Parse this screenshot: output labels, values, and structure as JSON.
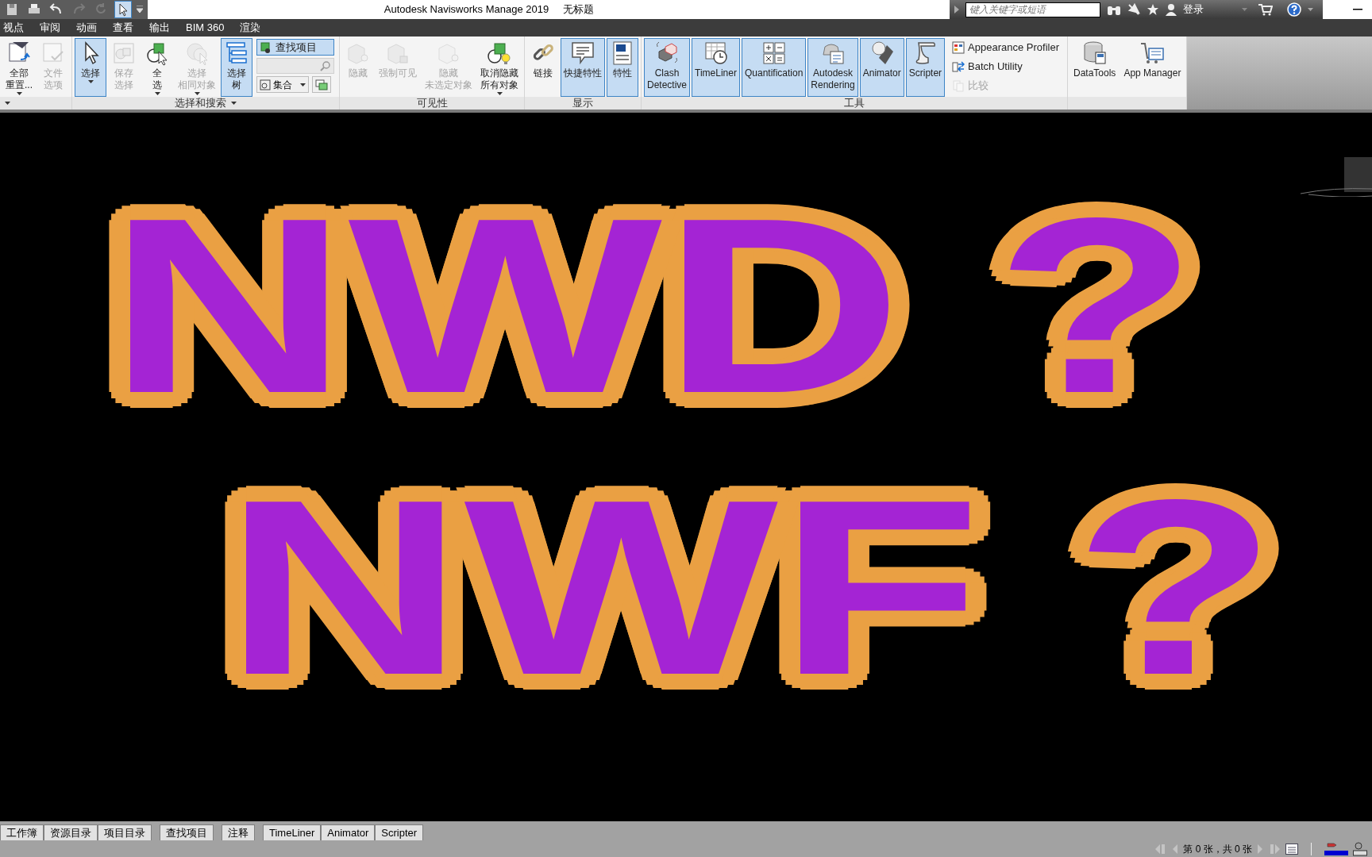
{
  "quick_access": [
    {
      "selected": false,
      "disabled": false
    },
    {
      "selected": false,
      "disabled": false
    },
    {
      "selected": false,
      "disabled": false
    },
    {
      "selected": false,
      "disabled": true
    },
    {
      "selected": false,
      "disabled": true
    },
    {
      "selected": true,
      "disabled": false
    }
  ],
  "title": "Autodesk Navisworks Manage 2019",
  "document": "无标题",
  "infocenter": {
    "placeholder": "键入关键字或短语",
    "login": "登录"
  },
  "menu": [
    "视点",
    "审阅",
    "动画",
    "查看",
    "输出",
    "BIM 360",
    "渲染"
  ],
  "ribbon": [
    {
      "menu": true,
      "items": [
        {
          "kind": "large",
          "lines": [
            "全部",
            "重置..."
          ],
          "dropdown": true,
          "disabled": false,
          "active": false
        },
        {
          "kind": "large",
          "lines": [
            "文件",
            "选项"
          ],
          "dropdown": false,
          "disabled": true,
          "active": false
        }
      ]
    },
    {
      "label": "选择和搜索",
      "menu": true,
      "items": [
        {
          "kind": "large",
          "label": "选择",
          "dropdown": true,
          "disabled": false,
          "active": true
        },
        {
          "kind": "large",
          "lines": [
            "保存",
            "选择"
          ],
          "dropdown": false,
          "disabled": true,
          "active": false
        },
        {
          "kind": "large",
          "lines": [
            "全",
            "选"
          ],
          "dropdown": true,
          "disabled": false,
          "active": false
        },
        {
          "kind": "large",
          "lines": [
            "选择",
            "相同对象"
          ],
          "dropdown": true,
          "disabled": true,
          "active": false
        },
        {
          "kind": "large",
          "lines": [
            "选择",
            "树"
          ],
          "dropdown": false,
          "disabled": false,
          "active": true
        },
        {
          "kind": "stack",
          "children": [
            {
              "kind": "small",
              "label": "查找项目",
              "disabled": false,
              "active": true
            },
            {
              "kind": "field"
            },
            {
              "kind": "combo",
              "label": "集合"
            }
          ]
        }
      ]
    },
    {
      "label": "可见性",
      "menu": false,
      "items": [
        {
          "kind": "large",
          "label": "隐藏",
          "dropdown": false,
          "disabled": true,
          "active": false
        },
        {
          "kind": "large",
          "label": "强制可见",
          "dropdown": false,
          "disabled": true,
          "active": false
        },
        {
          "kind": "large",
          "lines": [
            "隐藏",
            "未选定对象"
          ],
          "dropdown": false,
          "disabled": true,
          "active": false
        },
        {
          "kind": "large",
          "lines": [
            "取消隐藏",
            "所有对象"
          ],
          "dropdown": true,
          "disabled": false,
          "active": false
        }
      ]
    },
    {
      "label": "显示",
      "menu": false,
      "items": [
        {
          "kind": "large",
          "label": "链接",
          "dropdown": false,
          "disabled": false,
          "active": false
        },
        {
          "kind": "large",
          "label": "快捷特性",
          "dropdown": false,
          "disabled": false,
          "active": true
        },
        {
          "kind": "large",
          "label": "特性",
          "dropdown": false,
          "disabled": false,
          "active": true
        }
      ]
    },
    {
      "label": "工具",
      "menu": false,
      "items": [
        {
          "kind": "large",
          "lines": [
            "Clash",
            "Detective"
          ],
          "dropdown": false,
          "disabled": false,
          "active": true
        },
        {
          "kind": "large",
          "label": "TimeLiner",
          "dropdown": false,
          "disabled": false,
          "active": true
        },
        {
          "kind": "large",
          "label": "Quantification",
          "dropdown": false,
          "disabled": false,
          "active": true
        },
        {
          "kind": "large",
          "lines": [
            "Autodesk",
            "Rendering"
          ],
          "dropdown": false,
          "disabled": false,
          "active": true
        },
        {
          "kind": "large",
          "label": "Animator",
          "dropdown": false,
          "disabled": false,
          "active": true
        },
        {
          "kind": "large",
          "label": "Scripter",
          "dropdown": false,
          "disabled": false,
          "active": true
        },
        {
          "kind": "stack",
          "children": [
            {
              "kind": "small",
              "label": "Appearance Profiler",
              "disabled": false,
              "active": false
            },
            {
              "kind": "small",
              "label": "Batch Utility",
              "disabled": false,
              "active": false
            },
            {
              "kind": "small",
              "label": "比较",
              "disabled": true,
              "active": false
            }
          ]
        }
      ]
    },
    {
      "menu": false,
      "items": [
        {
          "kind": "large",
          "label": "DataTools",
          "dropdown": false,
          "disabled": false,
          "active": false
        },
        {
          "kind": "large",
          "label": "App Manager",
          "dropdown": false,
          "disabled": false,
          "active": false
        }
      ]
    }
  ],
  "overlay": {
    "lines": [
      "NWD ?",
      "NWF ?"
    ]
  },
  "tab_groups": [
    [
      "工作簿",
      "资源目录",
      "项目目录"
    ],
    [
      "查找项目"
    ],
    [
      "注释"
    ],
    [
      "TimeLiner",
      "Animator",
      "Scripter"
    ]
  ],
  "status": {
    "page_text": "第 0 张，共 0 张"
  }
}
